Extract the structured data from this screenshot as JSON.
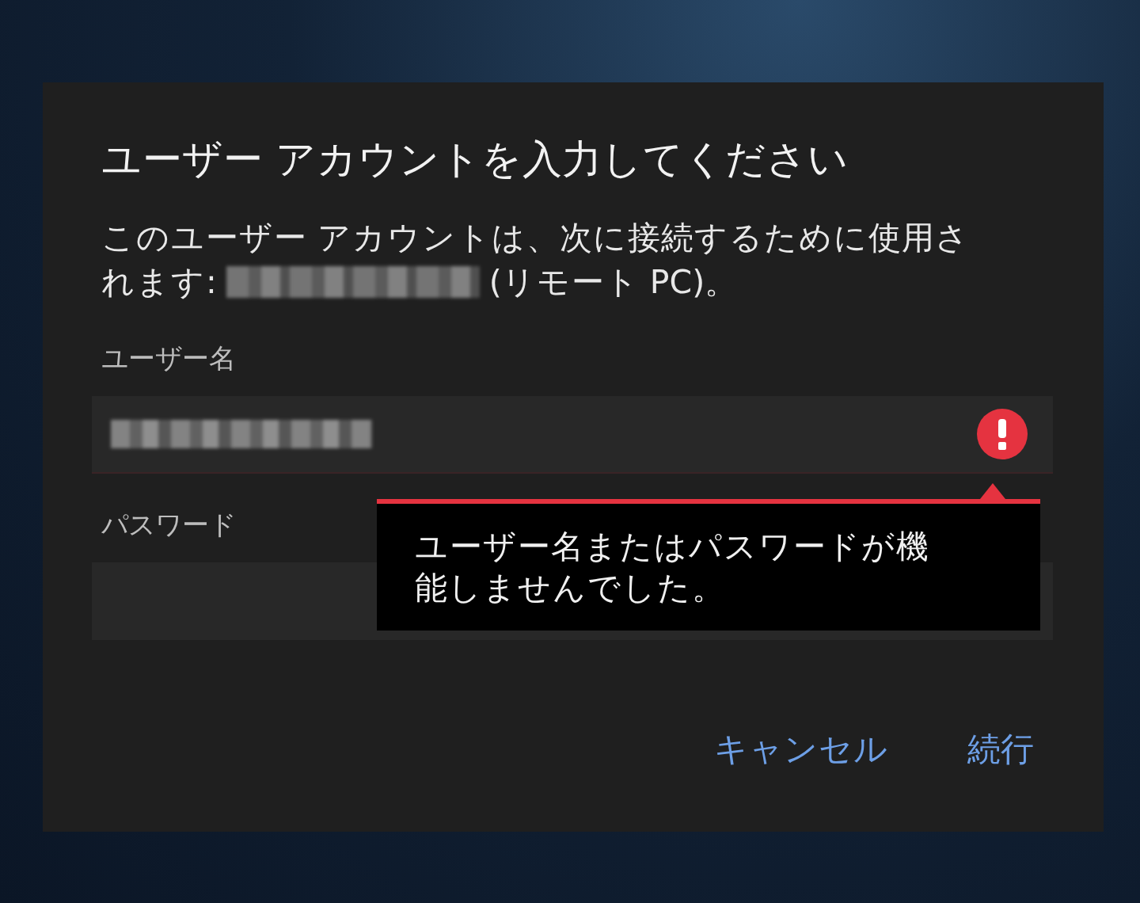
{
  "dialog": {
    "title": "ユーザー アカウントを入力してください",
    "description": {
      "line1": "このユーザー アカウントは、次に接続するために使用さ",
      "line2": "れます:",
      "after": "(リモート PC)。"
    },
    "fields": [
      {
        "label": "ユーザー名",
        "redacted": true,
        "error": true
      },
      {
        "label": "パスワード",
        "redacted": false,
        "error": false
      }
    ],
    "error_tooltip": {
      "message": "ユーザー名またはパスワードが機能しませんでした。"
    },
    "buttons": [
      {
        "label": "キャンセル"
      },
      {
        "label": "続行"
      }
    ]
  }
}
